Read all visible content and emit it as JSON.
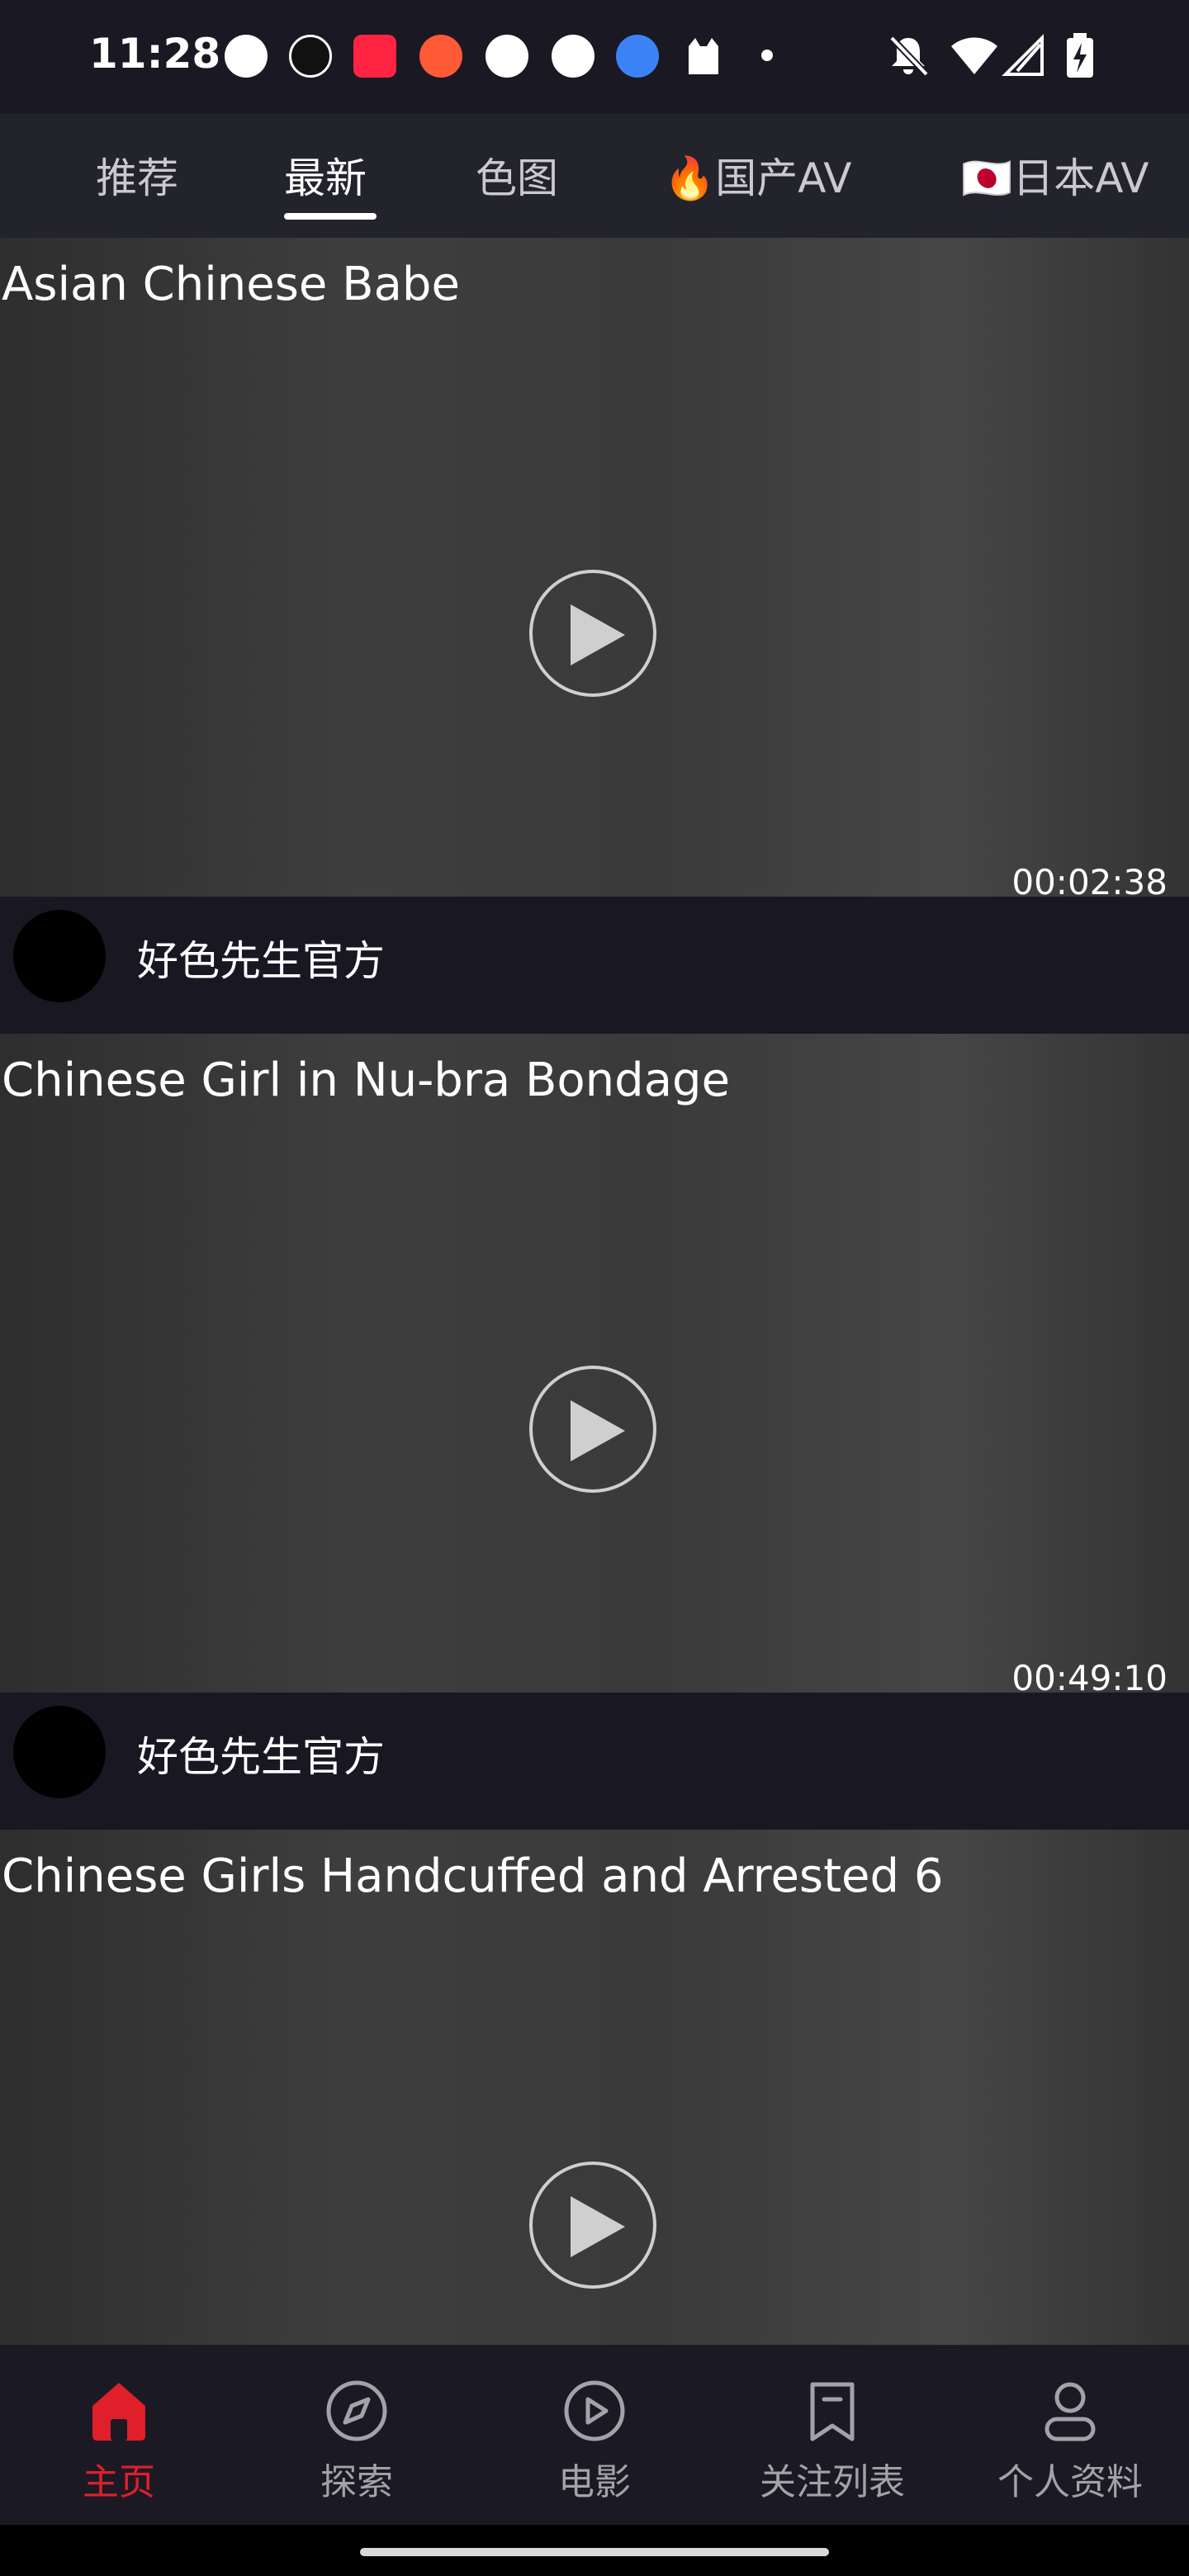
{
  "status_bar": {
    "time": "11:28"
  },
  "tabs": [
    {
      "label": "推荐",
      "active": false
    },
    {
      "label": "最新",
      "active": true
    },
    {
      "label": "色图",
      "active": false
    },
    {
      "label": "🔥国产AV",
      "active": false
    },
    {
      "label": "🇯🇵日本AV",
      "active": false
    }
  ],
  "feed": [
    {
      "title": "Asian Chinese Babe",
      "duration": "00:02:38",
      "author": "好色先生官方"
    },
    {
      "title": "Chinese Girl in Nu-bra Bondage",
      "duration": "00:49:10",
      "author": "好色先生官方"
    },
    {
      "title": "Chinese Girls Handcuffed and Arrested 6",
      "duration": "",
      "author": ""
    }
  ],
  "bottom_nav": [
    {
      "label": "主页",
      "icon": "home-icon",
      "active": true
    },
    {
      "label": "探索",
      "icon": "compass-icon",
      "active": false
    },
    {
      "label": "电影",
      "icon": "play-circle-icon",
      "active": false
    },
    {
      "label": "关注列表",
      "icon": "bookmark-icon",
      "active": false
    },
    {
      "label": "个人资料",
      "icon": "user-icon",
      "active": false
    }
  ],
  "colors": {
    "accent": "#e01f2b",
    "background": "#181722",
    "nav_inactive": "#a2a2a8"
  }
}
